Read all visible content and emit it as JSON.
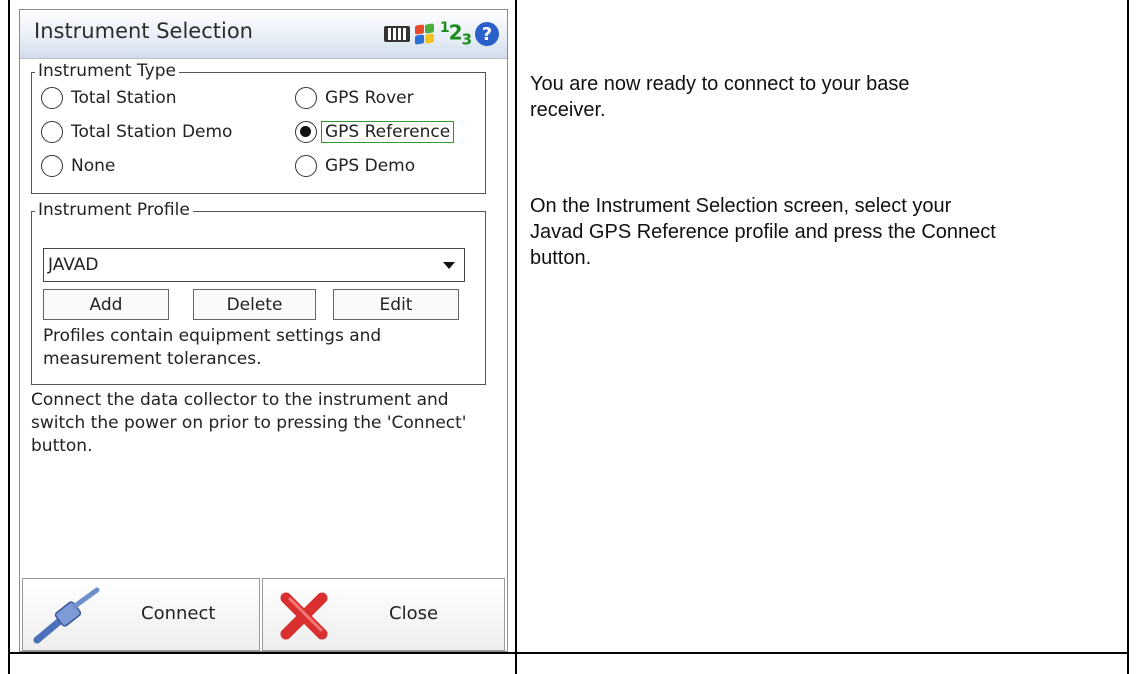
{
  "app": {
    "title": "Instrument Selection",
    "icons": [
      "keyboard-icon",
      "windows-flag-icon",
      "input-mode-icon",
      "help-icon"
    ],
    "input_mode": {
      "main": "1",
      "mid": "2",
      "sub": "3"
    },
    "help_glyph": "?"
  },
  "instrument_type": {
    "legend": "Instrument Type",
    "options": [
      {
        "label": "Total Station",
        "selected": false
      },
      {
        "label": "GPS Rover",
        "selected": false
      },
      {
        "label": "Total Station Demo",
        "selected": false
      },
      {
        "label": "GPS Reference",
        "selected": true
      },
      {
        "label": "None",
        "selected": false
      },
      {
        "label": "GPS Demo",
        "selected": false
      }
    ]
  },
  "instrument_profile": {
    "legend": "Instrument Profile",
    "selected": "JAVAD",
    "buttons": {
      "add": "Add",
      "delete": "Delete",
      "edit": "Edit"
    },
    "note": "Profiles contain equipment settings and measurement tolerances."
  },
  "connect_info": "Connect the data collector to the instrument and switch the power on prior to pressing the 'Connect' button.",
  "actions": {
    "connect": "Connect",
    "close": "Close"
  },
  "document": {
    "para1": "You are now ready to connect to your base receiver.",
    "para2": "On the Instrument Selection screen, select your Javad GPS Reference profile and press the Connect button."
  },
  "colors": {
    "accent_blue": "#2b5fc9",
    "focus_green": "#2e9a2e",
    "close_red": "#d92f2f"
  }
}
